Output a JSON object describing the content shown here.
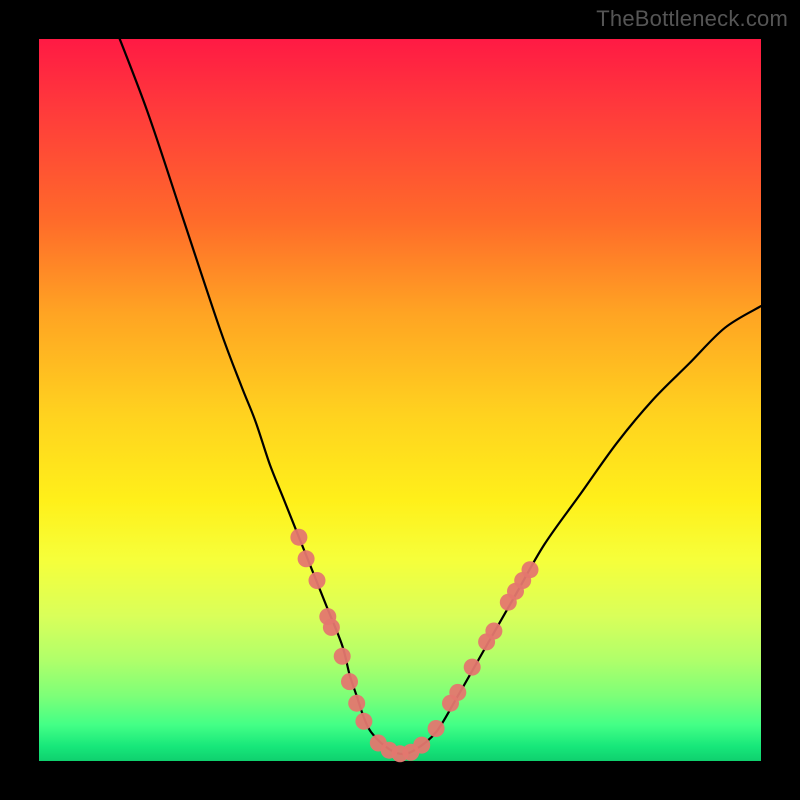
{
  "watermark": "TheBottleneck.com",
  "chart_data": {
    "type": "line",
    "title": "",
    "xlabel": "",
    "ylabel": "",
    "xlim": [
      0,
      100
    ],
    "ylim": [
      0,
      100
    ],
    "grid": false,
    "legend": false,
    "series": [
      {
        "name": "curve",
        "x": [
          10,
          15,
          20,
          25,
          28,
          30,
          32,
          34,
          36,
          38,
          40,
          42,
          43,
          44,
          45,
          46,
          48,
          50,
          52,
          55,
          58,
          62,
          66,
          70,
          75,
          80,
          85,
          90,
          95,
          100
        ],
        "y": [
          103,
          90,
          75,
          60,
          52,
          47,
          41,
          36,
          31,
          26,
          21,
          16,
          12,
          9,
          6,
          4,
          2,
          1,
          1.5,
          4,
          9,
          16,
          23,
          30,
          37,
          44,
          50,
          55,
          60,
          63
        ]
      }
    ],
    "markers": {
      "name": "highlighted-points",
      "color": "#e4776f",
      "points": [
        {
          "x": 36.0,
          "y": 31.0
        },
        {
          "x": 37.0,
          "y": 28.0
        },
        {
          "x": 38.5,
          "y": 25.0
        },
        {
          "x": 40.0,
          "y": 20.0
        },
        {
          "x": 40.5,
          "y": 18.5
        },
        {
          "x": 42.0,
          "y": 14.5
        },
        {
          "x": 43.0,
          "y": 11.0
        },
        {
          "x": 44.0,
          "y": 8.0
        },
        {
          "x": 45.0,
          "y": 5.5
        },
        {
          "x": 47.0,
          "y": 2.5
        },
        {
          "x": 48.5,
          "y": 1.5
        },
        {
          "x": 50.0,
          "y": 1.0
        },
        {
          "x": 51.5,
          "y": 1.2
        },
        {
          "x": 53.0,
          "y": 2.2
        },
        {
          "x": 55.0,
          "y": 4.5
        },
        {
          "x": 57.0,
          "y": 8.0
        },
        {
          "x": 58.0,
          "y": 9.5
        },
        {
          "x": 60.0,
          "y": 13.0
        },
        {
          "x": 62.0,
          "y": 16.5
        },
        {
          "x": 63.0,
          "y": 18.0
        },
        {
          "x": 65.0,
          "y": 22.0
        },
        {
          "x": 66.0,
          "y": 23.5
        },
        {
          "x": 67.0,
          "y": 25.0
        },
        {
          "x": 68.0,
          "y": 26.5
        }
      ]
    }
  }
}
